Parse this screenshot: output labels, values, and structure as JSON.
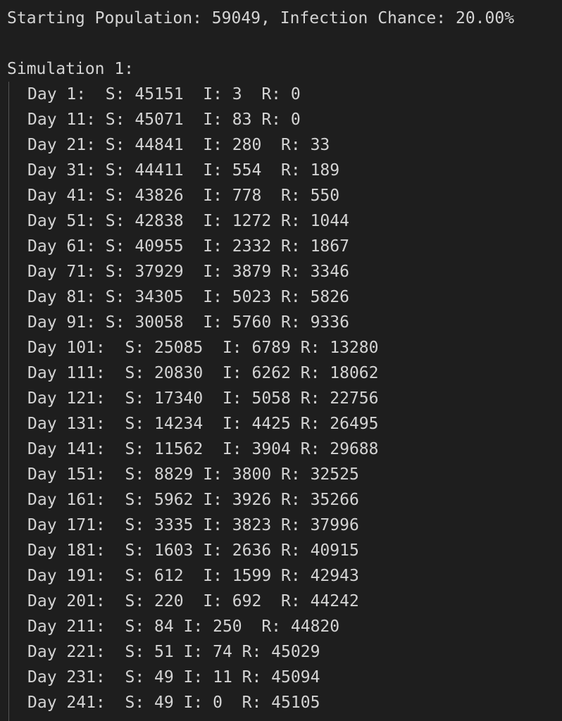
{
  "header": "Starting Population: 59049, Infection Chance: 20.00%",
  "simulation_label": "Simulation 1:",
  "lines": [
    "Day 1:  S: 45151  I: 3  R: 0",
    "Day 11: S: 45071  I: 83 R: 0",
    "Day 21: S: 44841  I: 280  R: 33",
    "Day 31: S: 44411  I: 554  R: 189",
    "Day 41: S: 43826  I: 778  R: 550",
    "Day 51: S: 42838  I: 1272 R: 1044",
    "Day 61: S: 40955  I: 2332 R: 1867",
    "Day 71: S: 37929  I: 3879 R: 3346",
    "Day 81: S: 34305  I: 5023 R: 5826",
    "Day 91: S: 30058  I: 5760 R: 9336",
    "Day 101:  S: 25085  I: 6789 R: 13280",
    "Day 111:  S: 20830  I: 6262 R: 18062",
    "Day 121:  S: 17340  I: 5058 R: 22756",
    "Day 131:  S: 14234  I: 4425 R: 26495",
    "Day 141:  S: 11562  I: 3904 R: 29688",
    "Day 151:  S: 8829 I: 3800 R: 32525",
    "Day 161:  S: 5962 I: 3926 R: 35266",
    "Day 171:  S: 3335 I: 3823 R: 37996",
    "Day 181:  S: 1603 I: 2636 R: 40915",
    "Day 191:  S: 612  I: 1599 R: 42943",
    "Day 201:  S: 220  I: 692  R: 44242",
    "Day 211:  S: 84 I: 250  R: 44820",
    "Day 221:  S: 51 I: 74 R: 45029",
    "Day 231:  S: 49 I: 11 R: 45094",
    "Day 241:  S: 49 I: 0  R: 45105"
  ]
}
